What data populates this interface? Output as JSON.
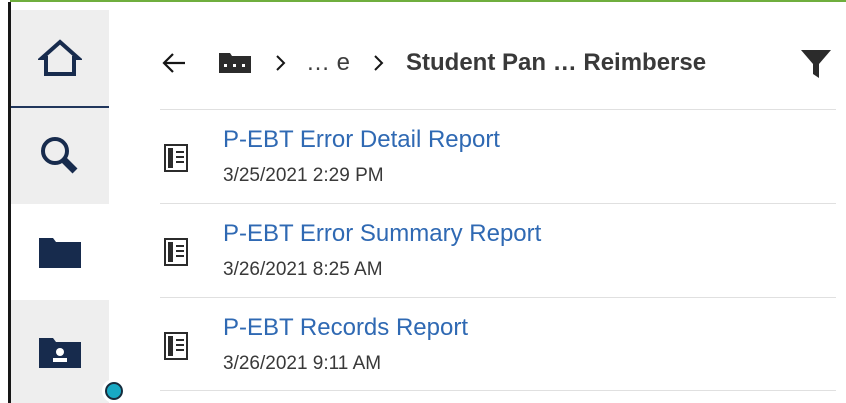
{
  "sidebar": {
    "items": [
      {
        "name": "home",
        "icon": "home-icon"
      },
      {
        "name": "search",
        "icon": "search-icon"
      },
      {
        "name": "content",
        "icon": "folder-icon"
      },
      {
        "name": "my-content",
        "icon": "user-folder-icon"
      }
    ],
    "notification_color": "#17a9c4"
  },
  "header": {
    "back_icon": "arrow-left-icon",
    "root_icon": "folder-icon",
    "crumb_middle": "… e",
    "crumb_current": "Student Pan … Reimberse",
    "filter_icon": "filter-icon"
  },
  "reports": [
    {
      "title": "P-EBT Error Detail Report",
      "date": "3/25/2021 2:29 PM"
    },
    {
      "title": "P-EBT Error Summary Report",
      "date": "3/26/2021 8:25 AM"
    },
    {
      "title": "P-EBT Records Report",
      "date": "3/26/2021 9:11 AM"
    }
  ],
  "colors": {
    "accent_line": "#6fae3e",
    "link": "#2f69b3",
    "sidebar_icon": "#172b4d",
    "sidebar_bg": "#eeeeee"
  }
}
